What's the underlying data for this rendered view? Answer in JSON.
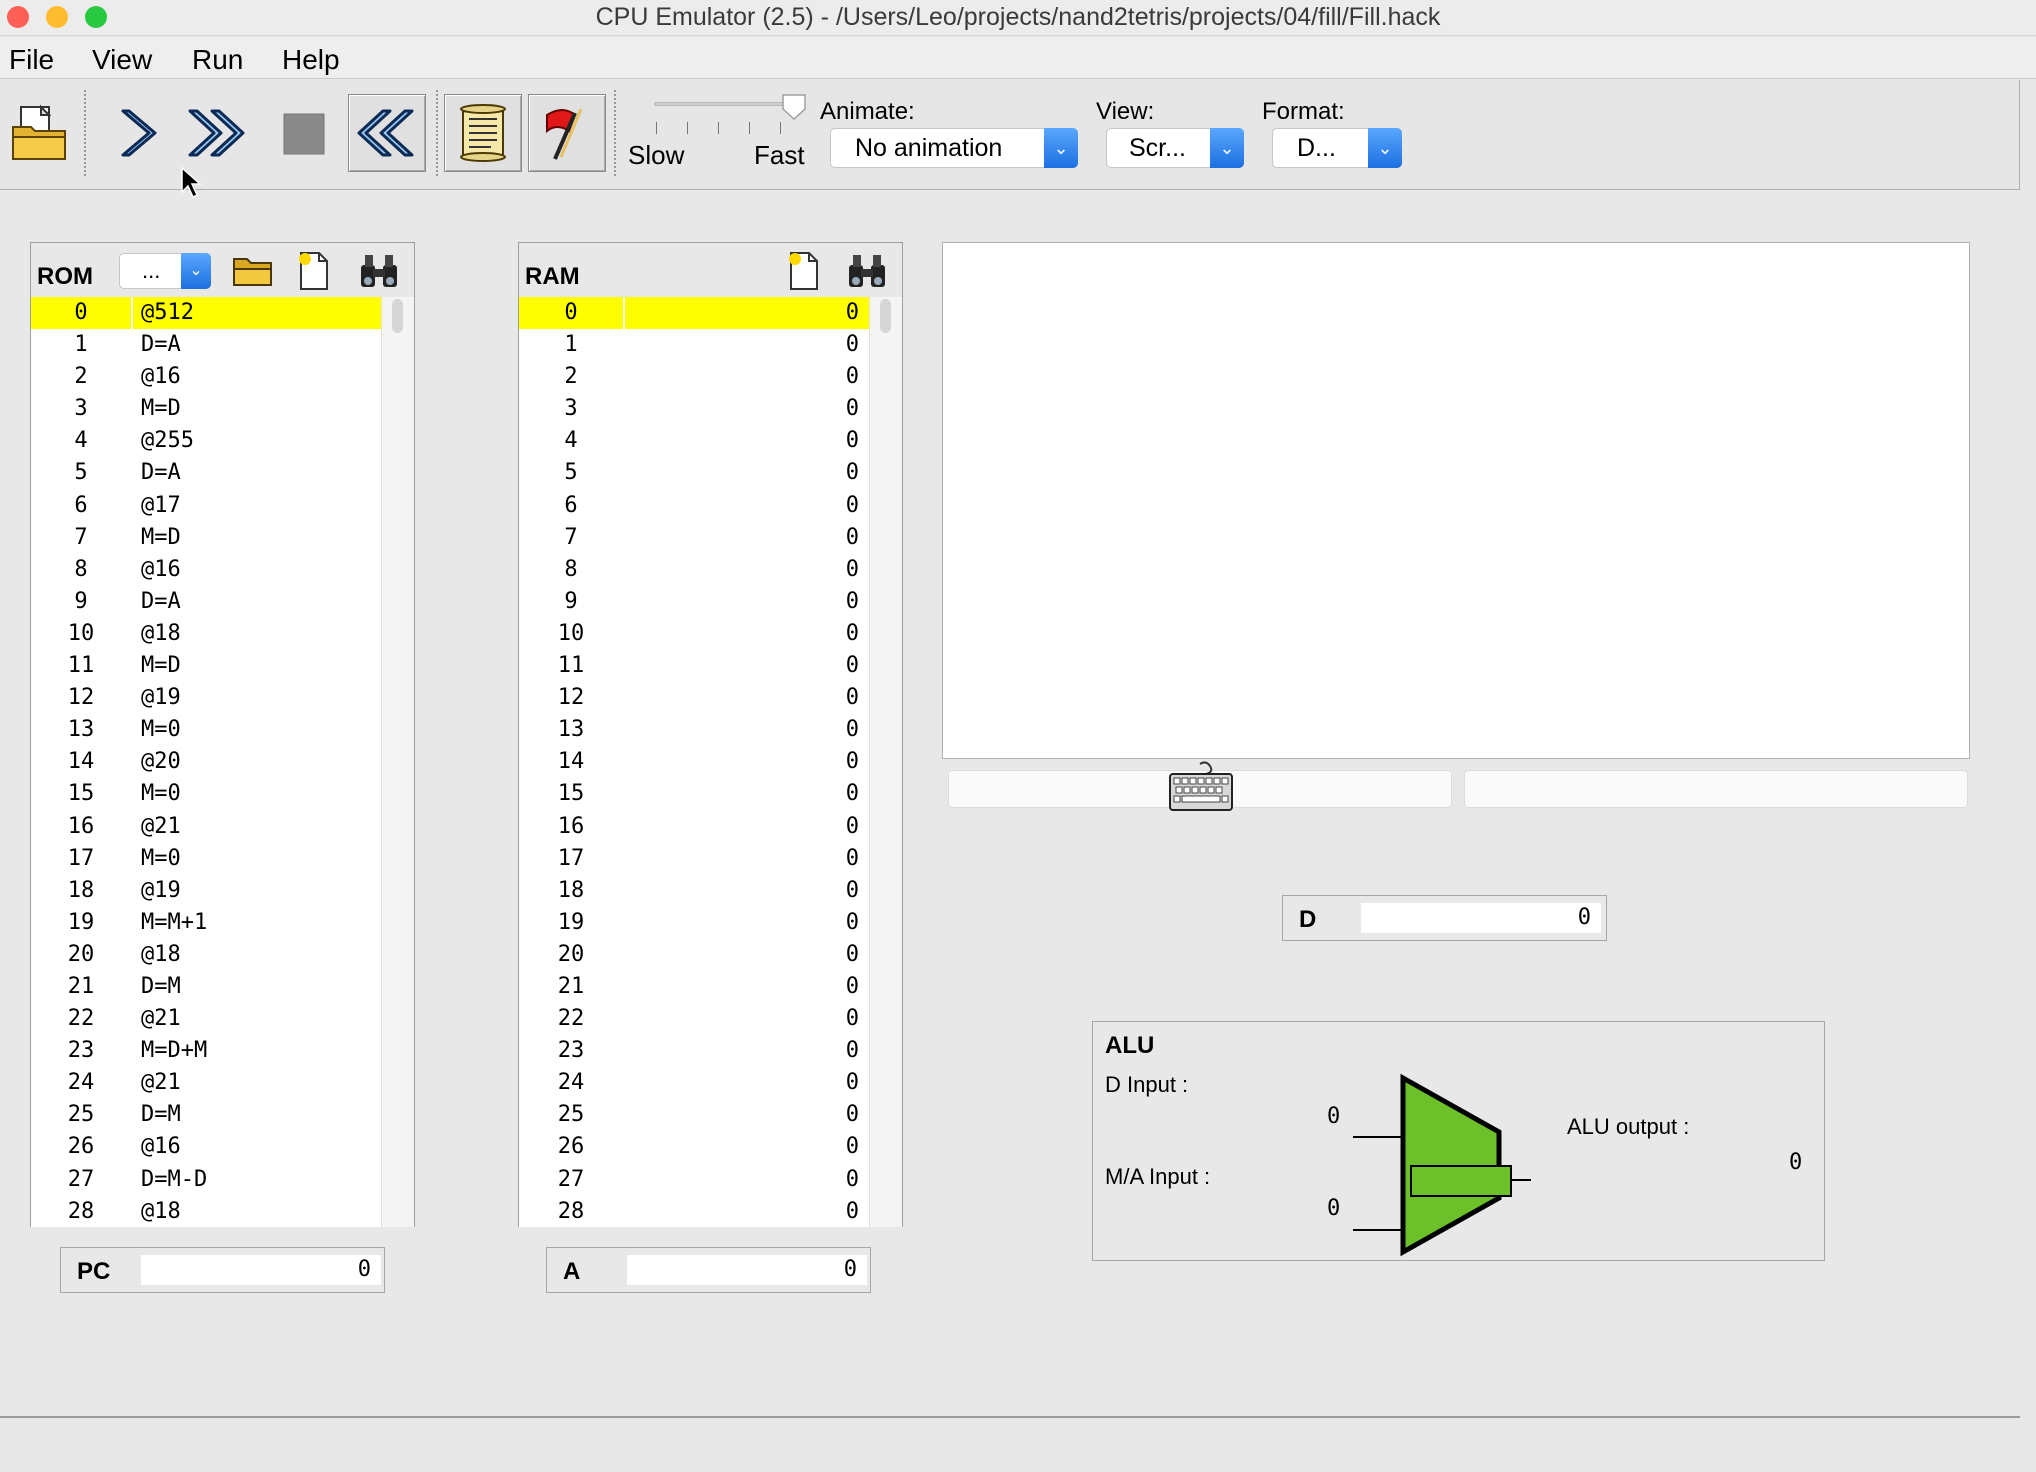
{
  "window": {
    "title": "CPU Emulator (2.5) - /Users/Leo/projects/nand2tetris/projects/04/fill/Fill.hack",
    "colors": {
      "close": "#fe5f57",
      "minimize": "#febc2e",
      "maximize": "#28c840"
    }
  },
  "menu": {
    "items": [
      {
        "label": "File"
      },
      {
        "label": "View"
      },
      {
        "label": "Run"
      },
      {
        "label": "Help"
      }
    ]
  },
  "toolbar": {
    "buttons": [
      {
        "icon": "load-program-icon"
      },
      {
        "icon": "single-step-icon"
      },
      {
        "icon": "run-icon"
      },
      {
        "icon": "stop-icon"
      },
      {
        "icon": "reset-icon"
      },
      {
        "icon": "script-icon"
      },
      {
        "icon": "breakpoints-flag-icon"
      }
    ],
    "speed": {
      "slow_label": "Slow",
      "fast_label": "Fast",
      "level": 1.0
    },
    "animate": {
      "label": "Animate:",
      "value": "No animation"
    },
    "view": {
      "label": "View:",
      "value": "Scr..."
    },
    "format": {
      "label": "Format:",
      "value": "D..."
    }
  },
  "rom": {
    "label": "ROM",
    "format_value": "...",
    "rows": [
      [
        "0",
        "@512"
      ],
      [
        "1",
        "D=A"
      ],
      [
        "2",
        "@16"
      ],
      [
        "3",
        "M=D"
      ],
      [
        "4",
        "@255"
      ],
      [
        "5",
        "D=A"
      ],
      [
        "6",
        "@17"
      ],
      [
        "7",
        "M=D"
      ],
      [
        "8",
        "@16"
      ],
      [
        "9",
        "D=A"
      ],
      [
        "10",
        "@18"
      ],
      [
        "11",
        "M=D"
      ],
      [
        "12",
        "@19"
      ],
      [
        "13",
        "M=0"
      ],
      [
        "14",
        "@20"
      ],
      [
        "15",
        "M=0"
      ],
      [
        "16",
        "@21"
      ],
      [
        "17",
        "M=0"
      ],
      [
        "18",
        "@19"
      ],
      [
        "19",
        "M=M+1"
      ],
      [
        "20",
        "@18"
      ],
      [
        "21",
        "D=M"
      ],
      [
        "22",
        "@21"
      ],
      [
        "23",
        "M=D+M"
      ],
      [
        "24",
        "@21"
      ],
      [
        "25",
        "D=M"
      ],
      [
        "26",
        "@16"
      ],
      [
        "27",
        "D=M-D"
      ],
      [
        "28",
        "@18"
      ]
    ],
    "highlight_color": "#ffff00"
  },
  "ram": {
    "label": "RAM",
    "rows": [
      [
        "0",
        "0"
      ],
      [
        "1",
        "0"
      ],
      [
        "2",
        "0"
      ],
      [
        "3",
        "0"
      ],
      [
        "4",
        "0"
      ],
      [
        "5",
        "0"
      ],
      [
        "6",
        "0"
      ],
      [
        "7",
        "0"
      ],
      [
        "8",
        "0"
      ],
      [
        "9",
        "0"
      ],
      [
        "10",
        "0"
      ],
      [
        "11",
        "0"
      ],
      [
        "12",
        "0"
      ],
      [
        "13",
        "0"
      ],
      [
        "14",
        "0"
      ],
      [
        "15",
        "0"
      ],
      [
        "16",
        "0"
      ],
      [
        "17",
        "0"
      ],
      [
        "18",
        "0"
      ],
      [
        "19",
        "0"
      ],
      [
        "20",
        "0"
      ],
      [
        "21",
        "0"
      ],
      [
        "22",
        "0"
      ],
      [
        "23",
        "0"
      ],
      [
        "24",
        "0"
      ],
      [
        "25",
        "0"
      ],
      [
        "26",
        "0"
      ],
      [
        "27",
        "0"
      ],
      [
        "28",
        "0"
      ]
    ]
  },
  "registers": {
    "pc": {
      "label": "PC",
      "value": "0"
    },
    "a": {
      "label": "A",
      "value": "0"
    },
    "d": {
      "label": "D",
      "value": "0"
    }
  },
  "alu": {
    "title": "ALU",
    "d_input_label": "D Input :",
    "d_input_value": "0",
    "ma_input_label": "M/A Input :",
    "ma_input_value": "0",
    "output_label": "ALU output :",
    "output_value": "0",
    "color": "#6cc02a"
  }
}
